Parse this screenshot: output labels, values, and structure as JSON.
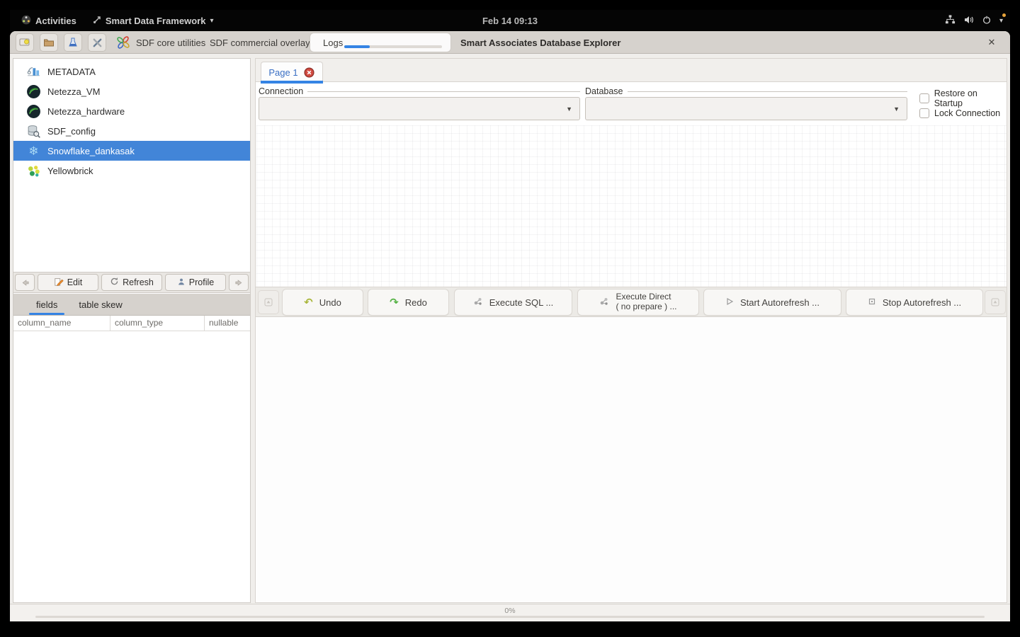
{
  "topbar": {
    "activities_label": "Activities",
    "app_menu_label": "Smart Data Framework",
    "clock": "Feb 14 09:13"
  },
  "window": {
    "toolbar": {
      "group1_label": "SDF core utilities",
      "group2_label": "SDF commercial overlay",
      "logs_label": "Logs",
      "title": "Smart Associates Database Explorer"
    },
    "sidebar": {
      "items": [
        {
          "label": "METADATA",
          "icon": "metadata-icon",
          "selected": false
        },
        {
          "label": "Netezza_VM",
          "icon": "netezza-icon",
          "selected": false
        },
        {
          "label": "Netezza_hardware",
          "icon": "netezza-icon",
          "selected": false
        },
        {
          "label": "SDF_config",
          "icon": "database-search-icon",
          "selected": false
        },
        {
          "label": "Snowflake_dankasak",
          "icon": "snowflake-icon",
          "selected": true
        },
        {
          "label": "Yellowbrick",
          "icon": "yellowbrick-icon",
          "selected": false
        }
      ],
      "edit_label": "Edit",
      "refresh_label": "Refresh",
      "profile_label": "Profile",
      "tabs": [
        {
          "label": "fields",
          "active": true
        },
        {
          "label": "table skew",
          "active": false
        }
      ],
      "columns": [
        "column_name",
        "column_type",
        "nullable"
      ]
    },
    "main": {
      "page_tab_label": "Page 1",
      "connection_label": "Connection",
      "database_label": "Database",
      "connection_value": "",
      "database_value": "",
      "restore_checkbox_label": "Restore on Startup",
      "restore_checked": false,
      "lock_checkbox_label": "Lock Connection",
      "lock_checked": false,
      "actions": {
        "undo": "Undo",
        "redo": "Redo",
        "execute_sql": "Execute SQL ...",
        "execute_direct_line1": "Execute Direct",
        "execute_direct_line2": "( no prepare ) ...",
        "start_autorefresh": "Start Autorefresh ...",
        "stop_autorefresh": "Stop Autorefresh ..."
      }
    },
    "statusbar": {
      "progress_text": "0%"
    }
  },
  "icons": {
    "close": "✕",
    "caret_down": "▾",
    "combo_arrow": "▼",
    "undo_arrow": "↶",
    "redo_arrow": "↷",
    "snowflake": "❄"
  },
  "colors": {
    "accent_blue": "#3584e4",
    "selection_blue": "#4285d8",
    "tab_close_red": "#c94438",
    "undo_green_yellow": "#a9b63a",
    "redo_green": "#55b244",
    "logs_progress_blue": "#3584e4"
  }
}
